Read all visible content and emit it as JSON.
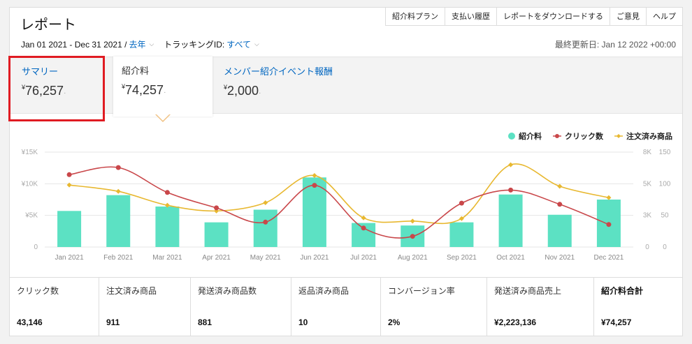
{
  "header": {
    "title": "レポート",
    "links": [
      "紹介料プラン",
      "支払い履歴",
      "レポートをダウンロードする",
      "ご意見",
      "ヘルプ"
    ]
  },
  "filters": {
    "date_range": "Jan 01 2021 - Dec 31 2021 /",
    "period": "去年",
    "tracking_label": "トラッキングID:",
    "tracking_value": "すべて",
    "last_updated": "最終更新日: Jan 12 2022 +00:00"
  },
  "tabs": [
    {
      "label": "サマリー",
      "value": "76,257",
      "currency": "¥"
    },
    {
      "label": "紹介料",
      "value": "74,257",
      "currency": "¥"
    },
    {
      "label": "メンバー紹介イベント報酬",
      "value": "2,000",
      "currency": "¥"
    }
  ],
  "legend": [
    "紹介料",
    "クリック数",
    "注文済み商品"
  ],
  "colors": {
    "bars": "#5ce1c3",
    "clicks": "#c9474a",
    "orders": "#e8b830",
    "link": "#0066c0",
    "highlight": "#e01b22"
  },
  "chart_data": {
    "type": "bar",
    "categories": [
      "Jan 2021",
      "Feb 2021",
      "Mar 2021",
      "Apr 2021",
      "May 2021",
      "Jun 2021",
      "Jul 2021",
      "Aug 2021",
      "Sep 2021",
      "Oct 2021",
      "Nov 2021",
      "Dec 2021"
    ],
    "y_ticks_left": [
      "0",
      "¥5K",
      "¥10K",
      "¥15K"
    ],
    "y_ticks_right_1": [
      "0",
      "3K",
      "5K",
      "8K"
    ],
    "y_ticks_right_2": [
      "0",
      "50",
      "100",
      "150"
    ],
    "ylim_left": [
      0,
      15000
    ],
    "ylim_right_1": [
      0,
      8000
    ],
    "ylim_right_2": [
      0,
      150
    ],
    "series": [
      {
        "name": "紹介料",
        "axis": "left",
        "kind": "bar",
        "values": [
          5700,
          8200,
          6400,
          3900,
          5900,
          11000,
          3800,
          3400,
          3900,
          8300,
          5100,
          7500
        ]
      },
      {
        "name": "クリック数",
        "axis": "right_1",
        "kind": "line",
        "values": [
          6100,
          6700,
          4600,
          3300,
          2100,
          5200,
          1600,
          900,
          3700,
          4800,
          3600,
          1900
        ]
      },
      {
        "name": "注文済み商品",
        "axis": "right_2",
        "kind": "line",
        "values": [
          98,
          88,
          66,
          57,
          70,
          113,
          46,
          41,
          45,
          130,
          96,
          78
        ]
      }
    ],
    "grid": true
  },
  "stats": [
    {
      "label": "クリック数",
      "value": "43,146"
    },
    {
      "label": "注文済み商品",
      "value": "911"
    },
    {
      "label": "発送済み商品数",
      "value": "881"
    },
    {
      "label": "返品済み商品",
      "value": "10"
    },
    {
      "label": "コンバージョン率",
      "value": "2%"
    },
    {
      "label": "発送済み商品売上",
      "value": "¥2,223,136"
    },
    {
      "label": "紹介料合計",
      "value": "¥74,257"
    }
  ]
}
